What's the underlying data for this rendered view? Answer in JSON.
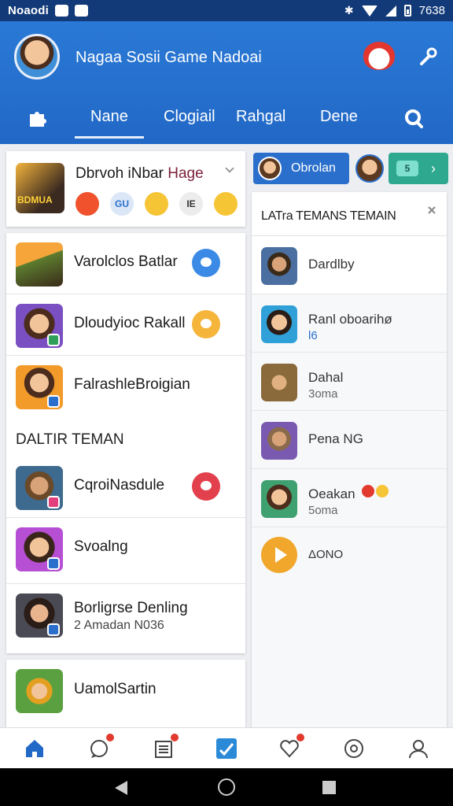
{
  "status_bar": {
    "carrier": "Noaodi",
    "time": "7638"
  },
  "header": {
    "app_title": "Nagaa Sosii Game Nadoai",
    "tabs": [
      {
        "label": "Nane",
        "active": true
      },
      {
        "label": "Clogiail",
        "active": false
      },
      {
        "label": "Rahgal",
        "active": false
      },
      {
        "label": "Dene",
        "active": false
      }
    ]
  },
  "featured": {
    "title_main": "Dbrvoh iNbar",
    "title_tail": "Hage",
    "thumb_caption": "BDMUA",
    "emojis": [
      {
        "name": "red-face",
        "text": "",
        "color": "#f0522e"
      },
      {
        "name": "blue-face",
        "text": "GU",
        "color": "#dbe6f7"
      },
      {
        "name": "yellow-face",
        "text": "",
        "color": "#f6c536"
      },
      {
        "name": "label",
        "text": "IE",
        "color": "#e9e9e9"
      },
      {
        "name": "smile",
        "text": "",
        "color": "#f6c536"
      }
    ]
  },
  "left_list": [
    {
      "name": "Varolclos Batlar",
      "sub": "",
      "dot_color": "#3b8ae6"
    },
    {
      "name": "Dloudyioc Rakall",
      "sub": "",
      "dot_color": "#f4b53a"
    },
    {
      "name": "FalrashleBroigian",
      "sub": "",
      "dot_color": ""
    }
  ],
  "section_label": "DALTIR TEMAN",
  "left_list_2": [
    {
      "name": "CqroiNasdule",
      "sub": "",
      "dot_color": "#e2404c"
    },
    {
      "name": "Svoalng",
      "sub": "",
      "dot_color": ""
    },
    {
      "name": "Borligrse Denling",
      "sub": "2 Amadan N036",
      "dot_color": ""
    }
  ],
  "bottom_card": {
    "name": "UamolSartin"
  },
  "chips": {
    "blue_label": "Obrolan",
    "teal_badge": "5"
  },
  "right_panel": {
    "title": "LATra TEMANS TEMAIN",
    "items": [
      {
        "name": "Dardlby",
        "sub": ""
      },
      {
        "name": "Ranl oboarihø",
        "sub": "l6"
      },
      {
        "name": "Dahal",
        "sub": "3oma"
      },
      {
        "name": "Pena NG",
        "sub": ""
      },
      {
        "name": "Oeakan",
        "sub": "5oma"
      },
      {
        "name": "ΔONO",
        "sub": ""
      }
    ]
  },
  "icons": {
    "bottom_nav": [
      "home-icon",
      "chat-icon",
      "calendar-icon",
      "twitter-icon",
      "heart-icon",
      "globe-icon",
      "profile-icon"
    ]
  }
}
